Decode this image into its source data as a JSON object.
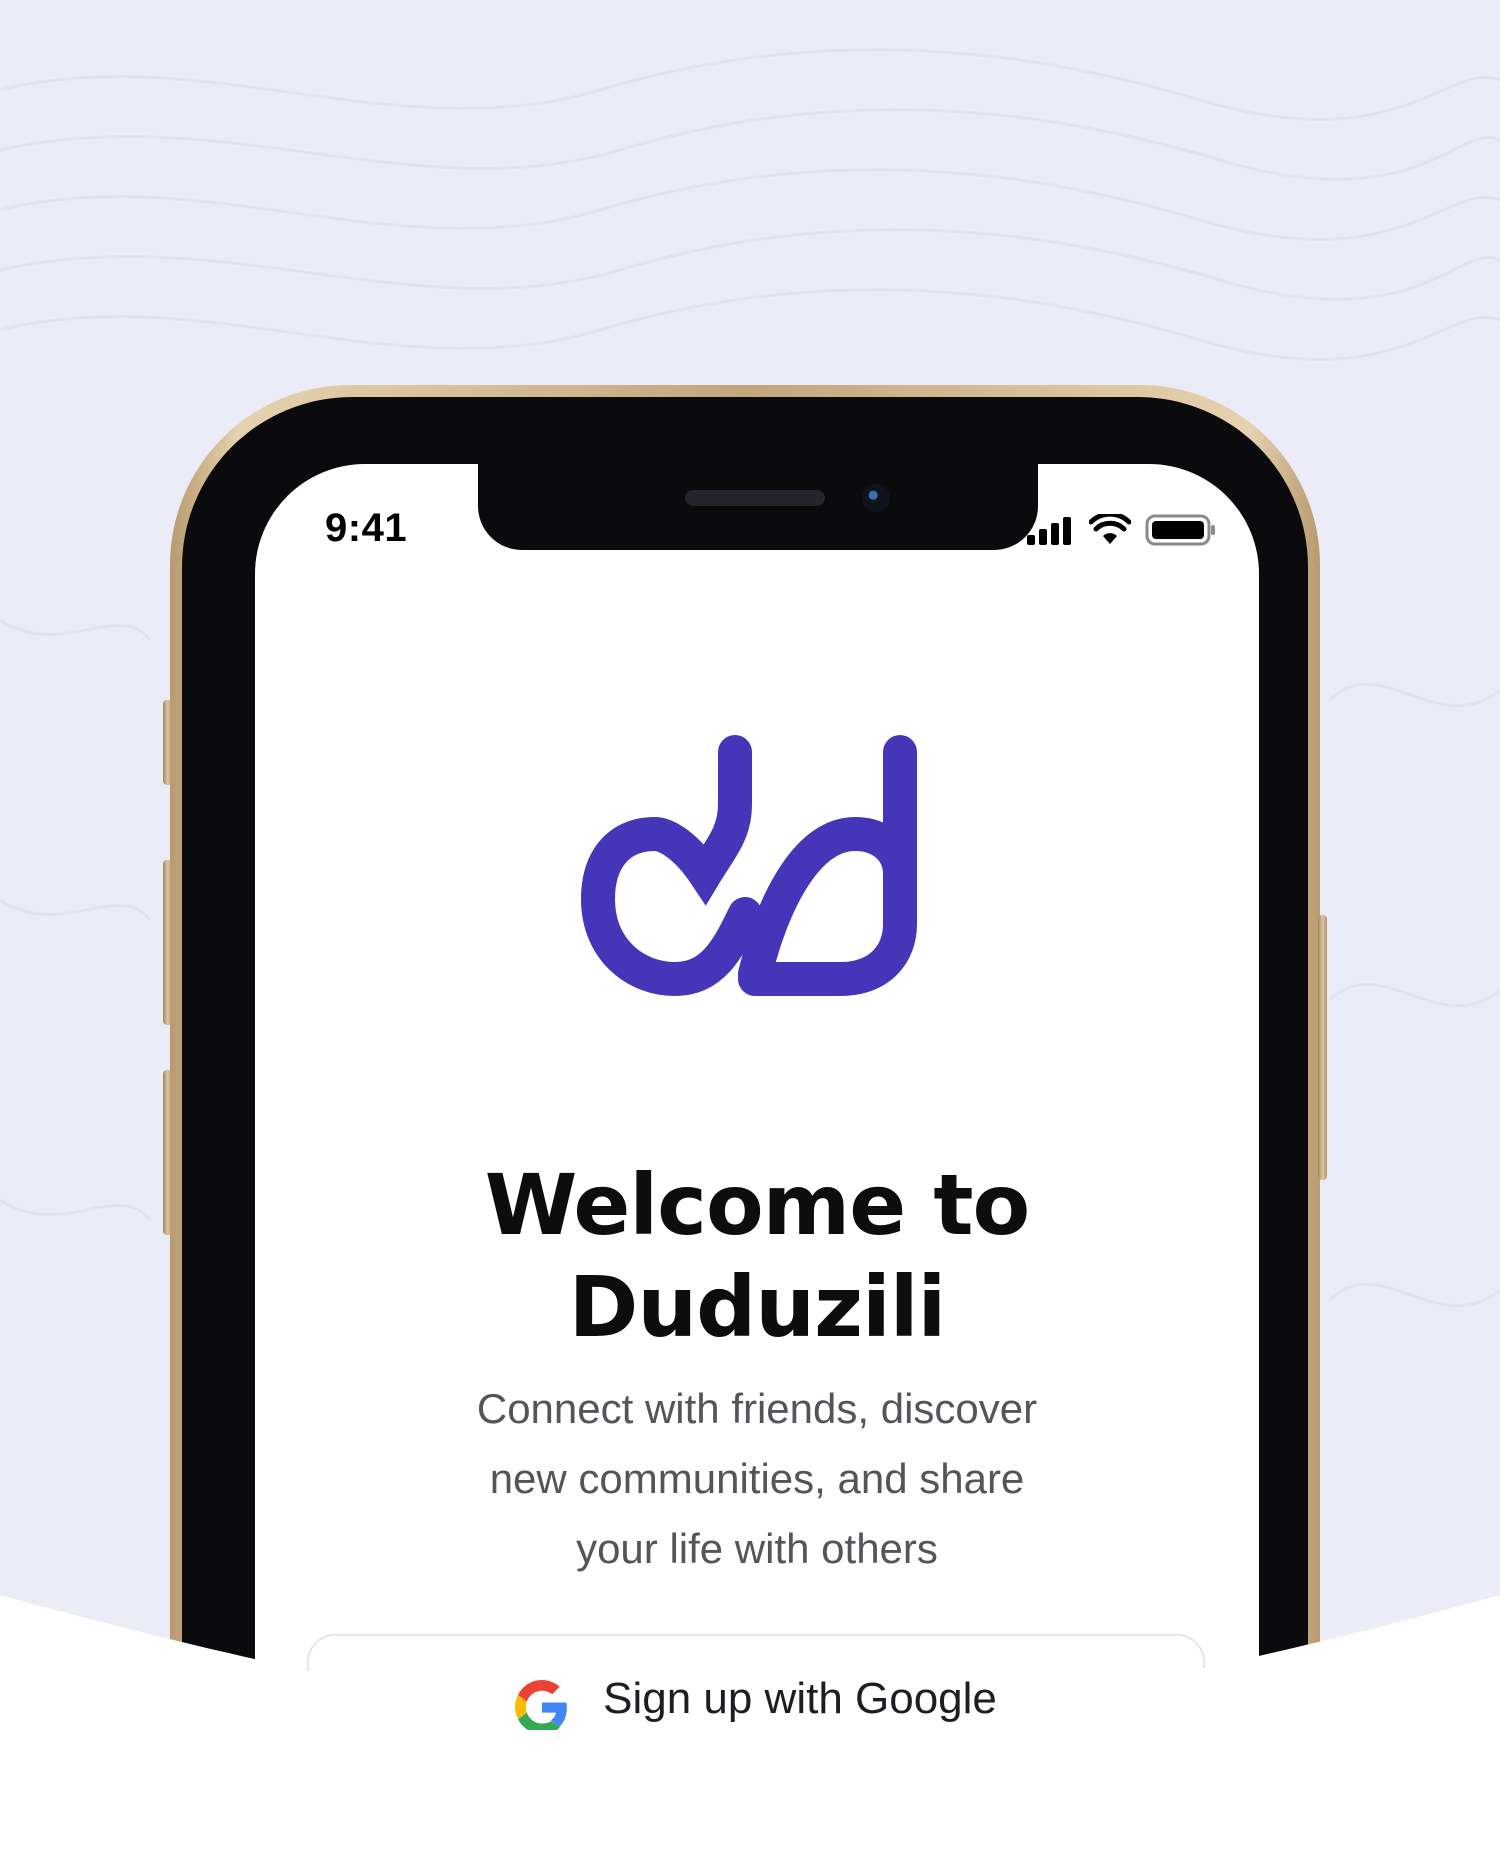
{
  "status_bar": {
    "time": "9:41"
  },
  "logo": {
    "name": "dd-logo",
    "color": "#4535b8"
  },
  "welcome": {
    "title_line1": "Welcome to",
    "title_line2": "Duduzili",
    "subtitle_line1": "Connect with friends, discover",
    "subtitle_line2": "new communities, and share",
    "subtitle_line3": "your life with others"
  },
  "google_button": {
    "label": "Sign up with Google",
    "icon": "google-g-icon"
  },
  "colors": {
    "background": "#ecebf8",
    "brand": "#4535b8",
    "title": "#0d0d0d",
    "subtitle": "#54545a"
  }
}
